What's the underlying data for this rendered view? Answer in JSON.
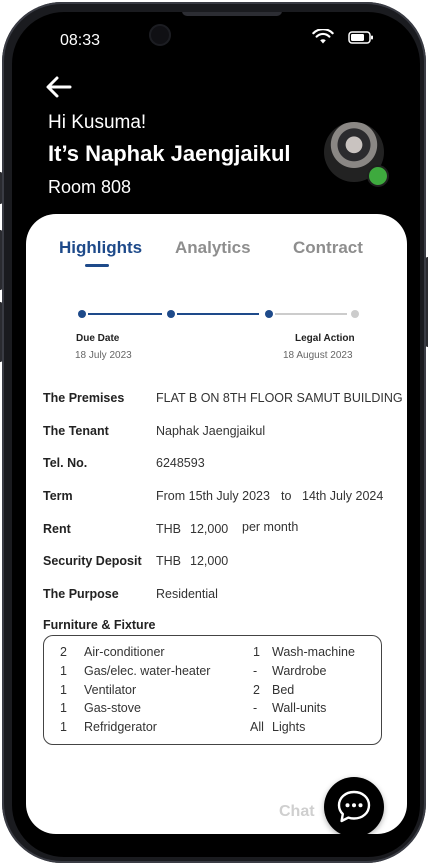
{
  "status_bar": {
    "time": "08:33"
  },
  "header": {
    "greeting": "Hi Kusuma!",
    "name": "It’s Naphak Jaengjaikul",
    "room": "Room 808"
  },
  "tabs": [
    {
      "label": "Highlights"
    },
    {
      "label": "Analytics"
    },
    {
      "label": "Contract"
    }
  ],
  "timeline": {
    "start": {
      "label": "Due Date",
      "date": "18 July 2023"
    },
    "end": {
      "label": "Legal Action",
      "date": "18 August 2023"
    },
    "colors": {
      "done": "#1e4a8a",
      "pending": "#cccccc"
    }
  },
  "contract": {
    "premises": {
      "label": "The Premises",
      "value": "FLAT B ON 8TH FLOOR SAMUT BUILDING"
    },
    "tenant": {
      "label": "The Tenant",
      "value": "Naphak Jaengjaikul"
    },
    "tel": {
      "label": "Tel. No.",
      "value": "6248593"
    },
    "term": {
      "label": "Term",
      "from": "From 15th July 2023",
      "to": "to",
      "until": "14th July 2024"
    },
    "rent": {
      "label": "Rent",
      "currency": "THB",
      "amount": "12,000",
      "period": "per month"
    },
    "deposit": {
      "label": "Security Deposit",
      "currency": "THB",
      "amount": "12,000"
    },
    "purpose": {
      "label": "The Purpose",
      "value": "Residential"
    }
  },
  "furniture": {
    "title": "Furniture & Fixture",
    "items": [
      {
        "qty": "2",
        "name": "Air-conditioner"
      },
      {
        "qty": "1",
        "name": "Gas/elec. water-heater"
      },
      {
        "qty": "1",
        "name": "Ventilator"
      },
      {
        "qty": "1",
        "name": "Gas-stove"
      },
      {
        "qty": "1",
        "name": "Refridgerator"
      },
      {
        "qty": "1",
        "name": "Wash-machine"
      },
      {
        "qty": "-",
        "name": "Wardrobe"
      },
      {
        "qty": "2",
        "name": "Bed"
      },
      {
        "qty": "-",
        "name": "Wall-units"
      },
      {
        "qty": "All",
        "name": "Lights"
      }
    ]
  },
  "chat": {
    "label": "Chat",
    "icon": "chat-bubble-icon"
  }
}
